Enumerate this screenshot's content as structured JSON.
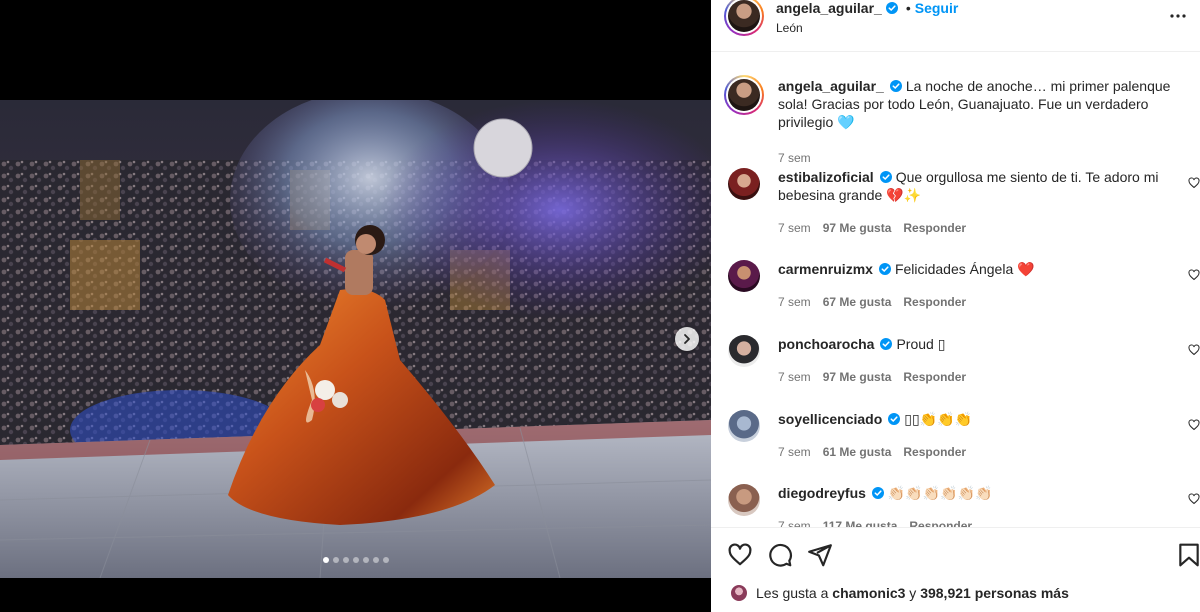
{
  "post": {
    "author": "angela_aguilar_",
    "follow_label": "Seguir",
    "separator": "•",
    "location": "León",
    "caption_text": "La noche de anoche… mi primer palenque sola! Gracias por todo León, Guanajuato. Fue un verdadero privilegio 🩵",
    "caption_time": "7 sem",
    "carousel": {
      "count": 7,
      "active_index": 0
    }
  },
  "comments": [
    {
      "username": "estibalizoficial",
      "text": "Que orgullosa me siento de ti. Te adoro mi bebesina grande 💔✨",
      "time": "7 sem",
      "likes": "97 Me gusta",
      "reply": "Responder"
    },
    {
      "username": "carmenruizmx",
      "text": "Felicidades Ángela ❤️",
      "time": "7 sem",
      "likes": "67 Me gusta",
      "reply": "Responder"
    },
    {
      "username": "ponchoarocha",
      "text": "Proud ▯",
      "time": "7 sem",
      "likes": "97 Me gusta",
      "reply": "Responder"
    },
    {
      "username": "soyellicenciado",
      "text": "▯▯👏👏👏",
      "time": "7 sem",
      "likes": "61 Me gusta",
      "reply": "Responder"
    },
    {
      "username": "diegodreyfus",
      "text": "👏🏻👏🏻👏🏻👏🏻👏🏻👏🏻",
      "time": "7 sem",
      "likes": "117 Me gusta",
      "reply": "Responder"
    }
  ],
  "likes_bar": {
    "prefix": "Les gusta a ",
    "user": "chamonic3",
    "middle": " y ",
    "count": "398,921 personas más"
  },
  "colors": {
    "accent_blue": "#0095f6",
    "verified_blue": "#0095f6",
    "muted_text": "#737373",
    "text": "#262626"
  },
  "icons": [
    "verified-badge-icon",
    "more-options-icon",
    "heart-icon",
    "comment-icon",
    "share-icon",
    "bookmark-icon",
    "chevron-right-icon"
  ]
}
